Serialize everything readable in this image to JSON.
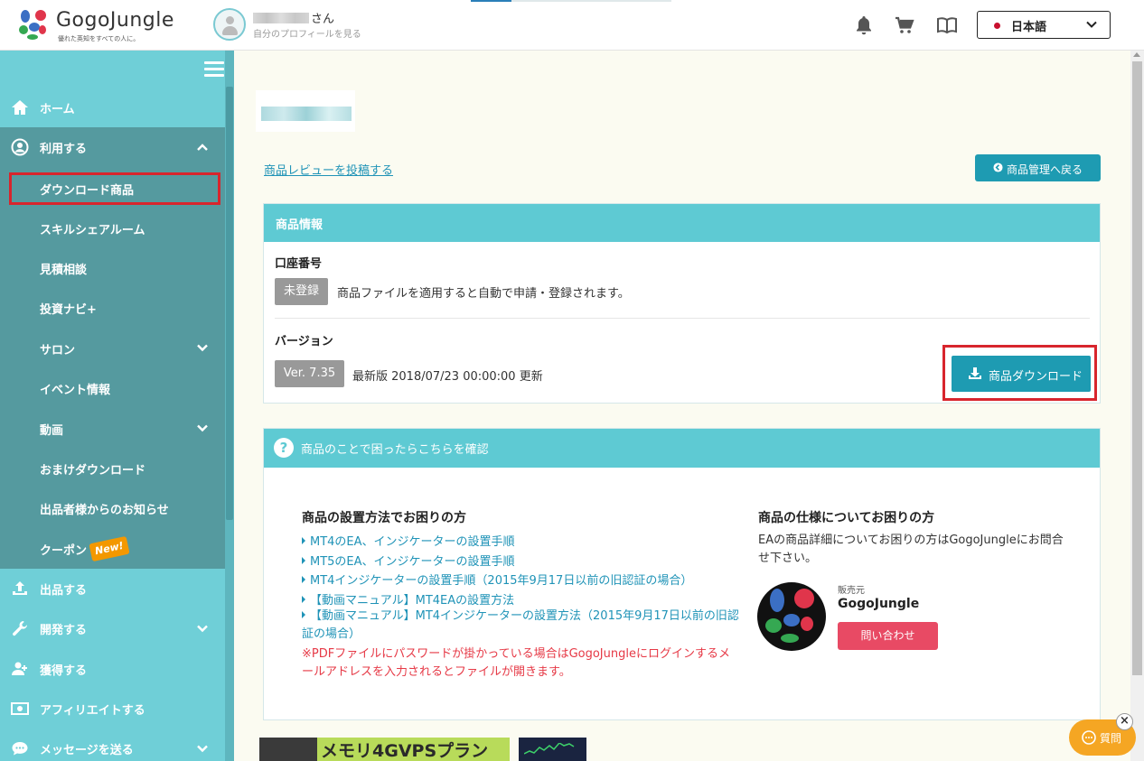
{
  "header": {
    "logo_text": "GogoJungle",
    "logo_tagline": "優れた英知をすべての人に。",
    "user_suffix": "さん",
    "user_profile_link": "自分のプロフィールを見る",
    "language": "日本語"
  },
  "sidebar": {
    "items": [
      {
        "label": "ホーム"
      },
      {
        "label": "利用する"
      },
      {
        "label": "出品する"
      },
      {
        "label": "開発する"
      },
      {
        "label": "獲得する"
      },
      {
        "label": "アフィリエイトする"
      },
      {
        "label": "メッセージを送る"
      }
    ],
    "sub_items": [
      {
        "label": "ダウンロード商品"
      },
      {
        "label": "スキルシェアルーム"
      },
      {
        "label": "見積相談"
      },
      {
        "label": "投資ナビ+"
      },
      {
        "label": "サロン"
      },
      {
        "label": "イベント情報"
      },
      {
        "label": "動画"
      },
      {
        "label": "おまけダウンロード"
      },
      {
        "label": "出品者様からのお知らせ"
      },
      {
        "label": "クーポン"
      }
    ],
    "new_badge": "New!"
  },
  "main": {
    "review_link": "商品レビューを投稿する",
    "back_button": "商品管理へ戻る",
    "product_info": {
      "heading": "商品情報",
      "account_title": "口座番号",
      "account_status": "未登録",
      "account_note": "商品ファイルを適用すると自動で申請・登録されます。",
      "version_title": "バージョン",
      "version_tag": "Ver. 7.35",
      "version_note": "最新版 2018/07/23 00:00:00 更新",
      "download_button": "商品ダウンロード"
    },
    "help": {
      "heading": "商品のことで困ったらこちらを確認",
      "setup_title": "商品の設置方法でお困りの方",
      "setup_links": [
        "MT4のEA、インジケーターの設置手順",
        "MT5のEA、インジケーターの設置手順",
        "MT4インジケーターの設置手順（2015年9月17日以前の旧認証の場合）",
        "【動画マニュアル】MT4EAの設置方法",
        "【動画マニュアル】MT4インジケーターの設置方法（2015年9月17日以前の旧認証の場合）"
      ],
      "pdf_note": "※PDFファイルにパスワードが掛かっている場合はGogoJungleにログインするメールアドレスを入力されるとファイルが開きます。",
      "spec_title": "商品の仕様についてお困りの方",
      "spec_desc": "EAの商品詳細についてお困りの方はGogoJungleにお問合せ下さい。",
      "seller_label": "販売元",
      "seller_name": "GogoJungle",
      "contact_button": "問い合わせ"
    },
    "banner_text": "メモリ4GVPSプラン"
  },
  "chat": {
    "ask_label": "質問",
    "close_symbol": "×"
  }
}
